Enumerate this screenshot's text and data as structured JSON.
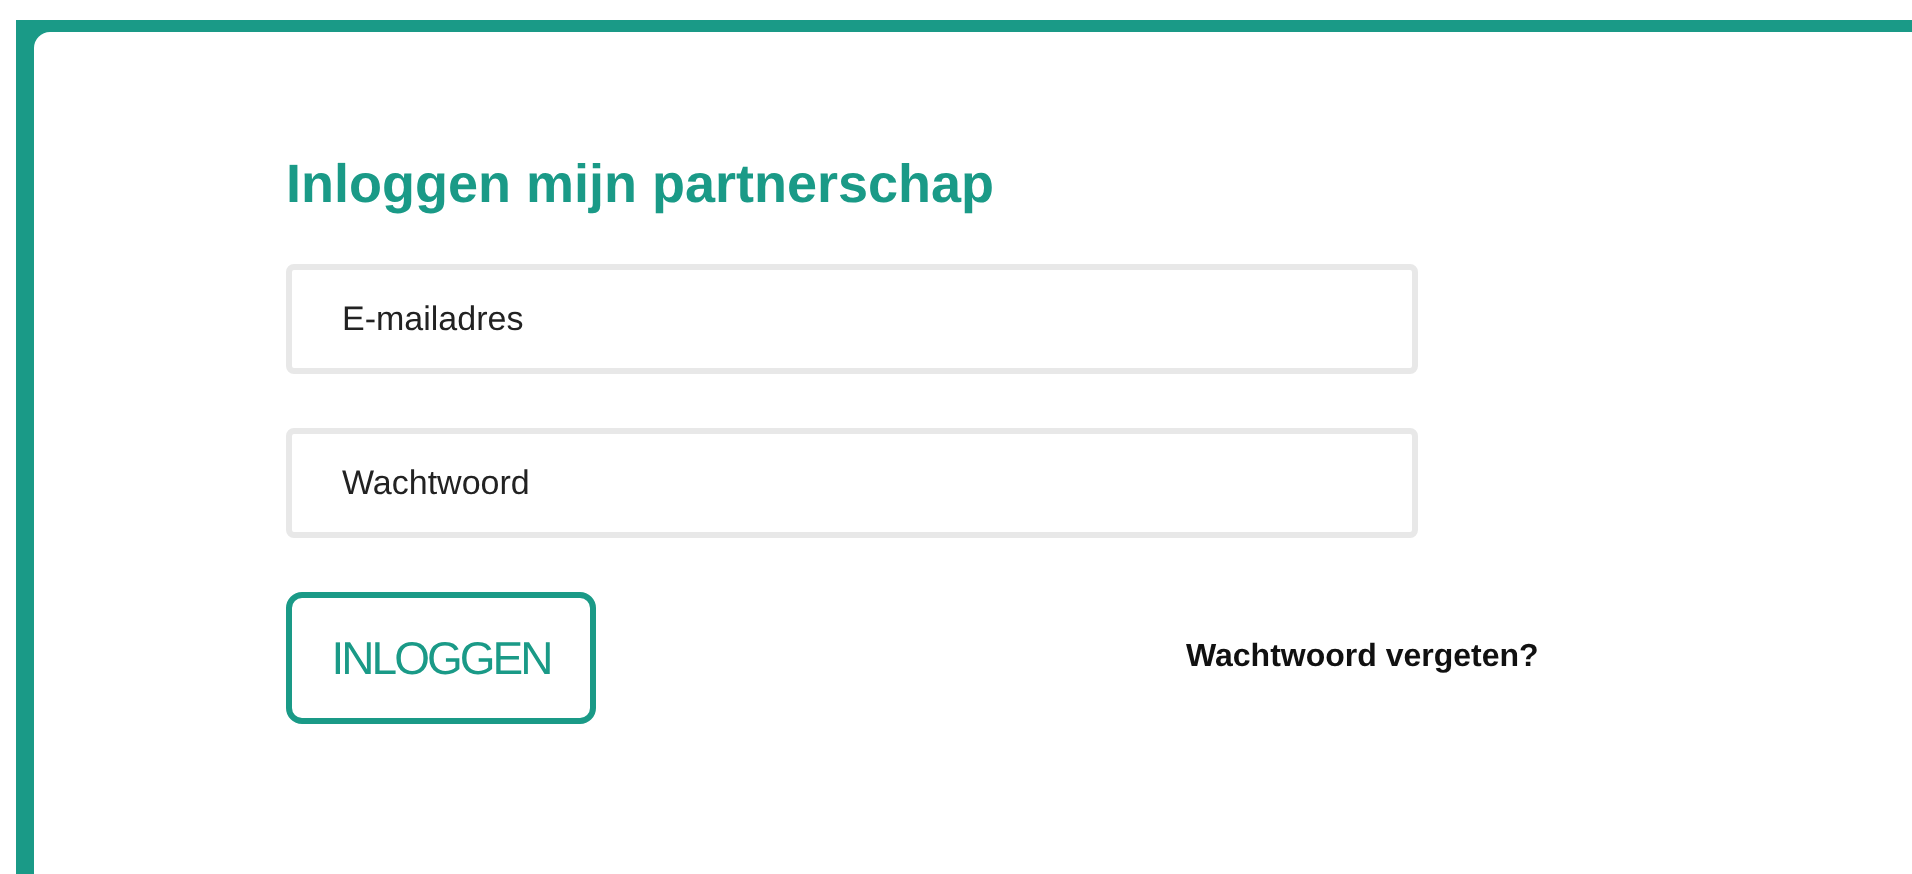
{
  "title": "Inloggen mijn partnerschap",
  "fields": [
    {
      "placeholder": "E-mailadres"
    },
    {
      "placeholder": "Wachtwoord"
    }
  ],
  "login_button": "INLOGGEN",
  "forgot_link": "Wachtwoord vergeten?"
}
